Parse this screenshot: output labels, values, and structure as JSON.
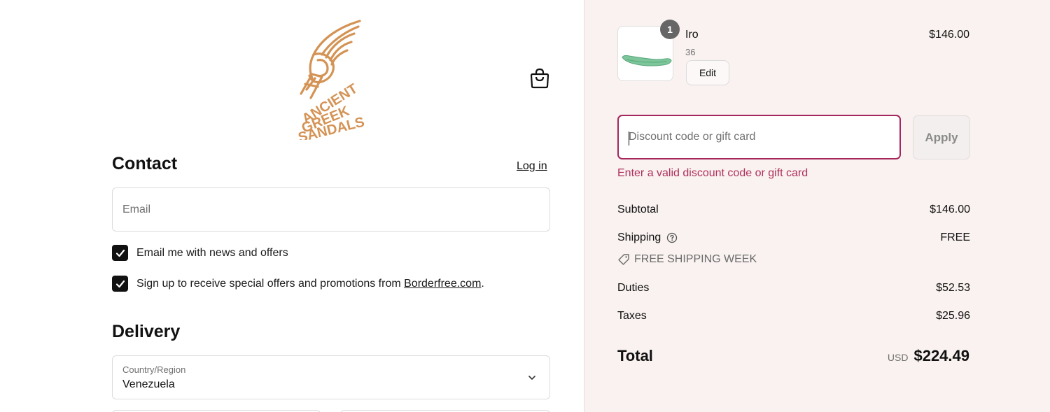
{
  "brand": {
    "logo_text": "ANCIENT GREEK SANDALS"
  },
  "header": {
    "cart_icon": "shopping-bag-icon"
  },
  "contact": {
    "heading": "Contact",
    "login_label": "Log in",
    "email_placeholder": "Email",
    "checkboxes": [
      {
        "label": "Email me with news and offers",
        "checked": true
      },
      {
        "label_prefix": "Sign up to receive special offers and promotions from ",
        "link": "Borderfree.com",
        "label_suffix": ".",
        "checked": true
      }
    ]
  },
  "delivery": {
    "heading": "Delivery",
    "country_label": "Country/Region",
    "country_value": "Venezuela"
  },
  "order": {
    "item": {
      "name": "Iro",
      "variant": "36",
      "quantity": "1",
      "price": "$146.00",
      "edit_label": "Edit"
    },
    "discount": {
      "placeholder": "Discount code or gift card",
      "apply_label": "Apply",
      "error": "Enter a valid discount code or gift card"
    },
    "summary": {
      "subtotal_label": "Subtotal",
      "subtotal_value": "$146.00",
      "shipping_label": "Shipping",
      "shipping_value": "FREE",
      "promo_label": "FREE SHIPPING WEEK",
      "duties_label": "Duties",
      "duties_value": "$52.53",
      "taxes_label": "Taxes",
      "taxes_value": "$25.96",
      "total_label": "Total",
      "currency": "USD",
      "total_value": "$224.49"
    }
  },
  "colors": {
    "accent_error": "#a3275c",
    "sidebar_bg": "#f9f2f0",
    "logo": "#d49355"
  }
}
